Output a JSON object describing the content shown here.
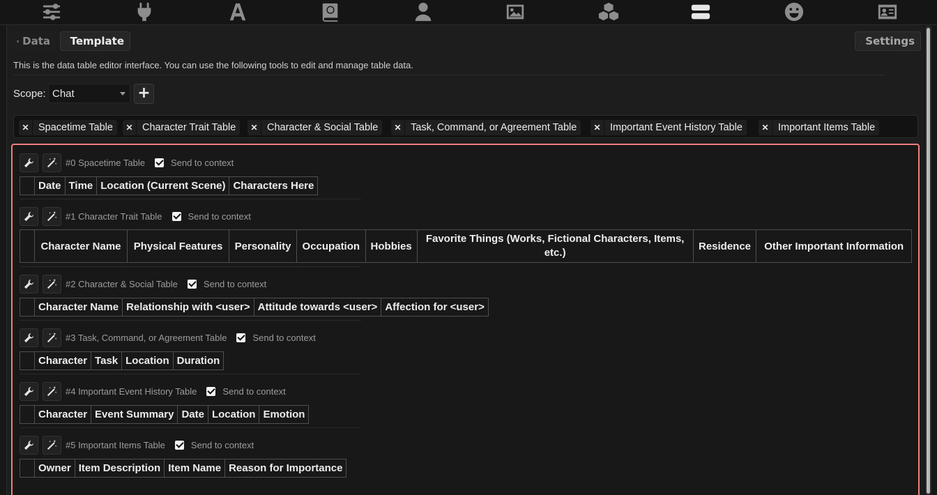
{
  "top_icons": [
    "sliders-icon",
    "plug-icon",
    "font-icon",
    "book-globe-icon",
    "user-icon",
    "image-icon",
    "cubes-icon",
    "server-icon",
    "smile-icon",
    "id-card-icon"
  ],
  "tabs": {
    "data": "Data",
    "template": "Template",
    "settings": "Settings"
  },
  "description": "This is the data table editor interface. You can use the following tools to edit and manage table data.",
  "scope": {
    "label": "Scope:",
    "value": "Chat",
    "add": "+"
  },
  "chips": [
    "Spacetime Table",
    "Character Trait Table",
    "Character &  Social Table",
    "Task, Command, or Agreement Table",
    "Important Event History Table",
    "Important Items Table"
  ],
  "send_label": "Send to context",
  "tables": [
    {
      "title": "#0 Spacetime Table",
      "send": true,
      "columns": [
        "Date",
        "Time",
        "Location (Current Scene)",
        "Characters Here"
      ]
    },
    {
      "title": "#1 Character Trait Table",
      "send": true,
      "columns": [
        "Character Name",
        "Physical Features",
        "Personality",
        "Occupation",
        "Hobbies",
        "Favorite Things (Works, Fictional Characters, Items, etc.)",
        "Residence",
        "Other Important Information"
      ]
    },
    {
      "title": "#2 Character & Social Table",
      "send": true,
      "columns": [
        "Character Name",
        "Relationship with <user>",
        "Attitude towards <user>",
        "Affection for <user>"
      ]
    },
    {
      "title": "#3 Task, Command, or Agreement Table",
      "send": true,
      "columns": [
        "Character",
        "Task",
        "Location",
        "Duration"
      ]
    },
    {
      "title": "#4 Important Event History Table",
      "send": true,
      "columns": [
        "Character",
        "Event Summary",
        "Date",
        "Location",
        "Emotion"
      ]
    },
    {
      "title": "#5 Important Items Table",
      "send": true,
      "columns": [
        "Owner",
        "Item Description",
        "Item Name",
        "Reason for Importance"
      ]
    }
  ],
  "colors": {
    "accent_border": "#f07e7e",
    "background": "#1d1d1d"
  }
}
